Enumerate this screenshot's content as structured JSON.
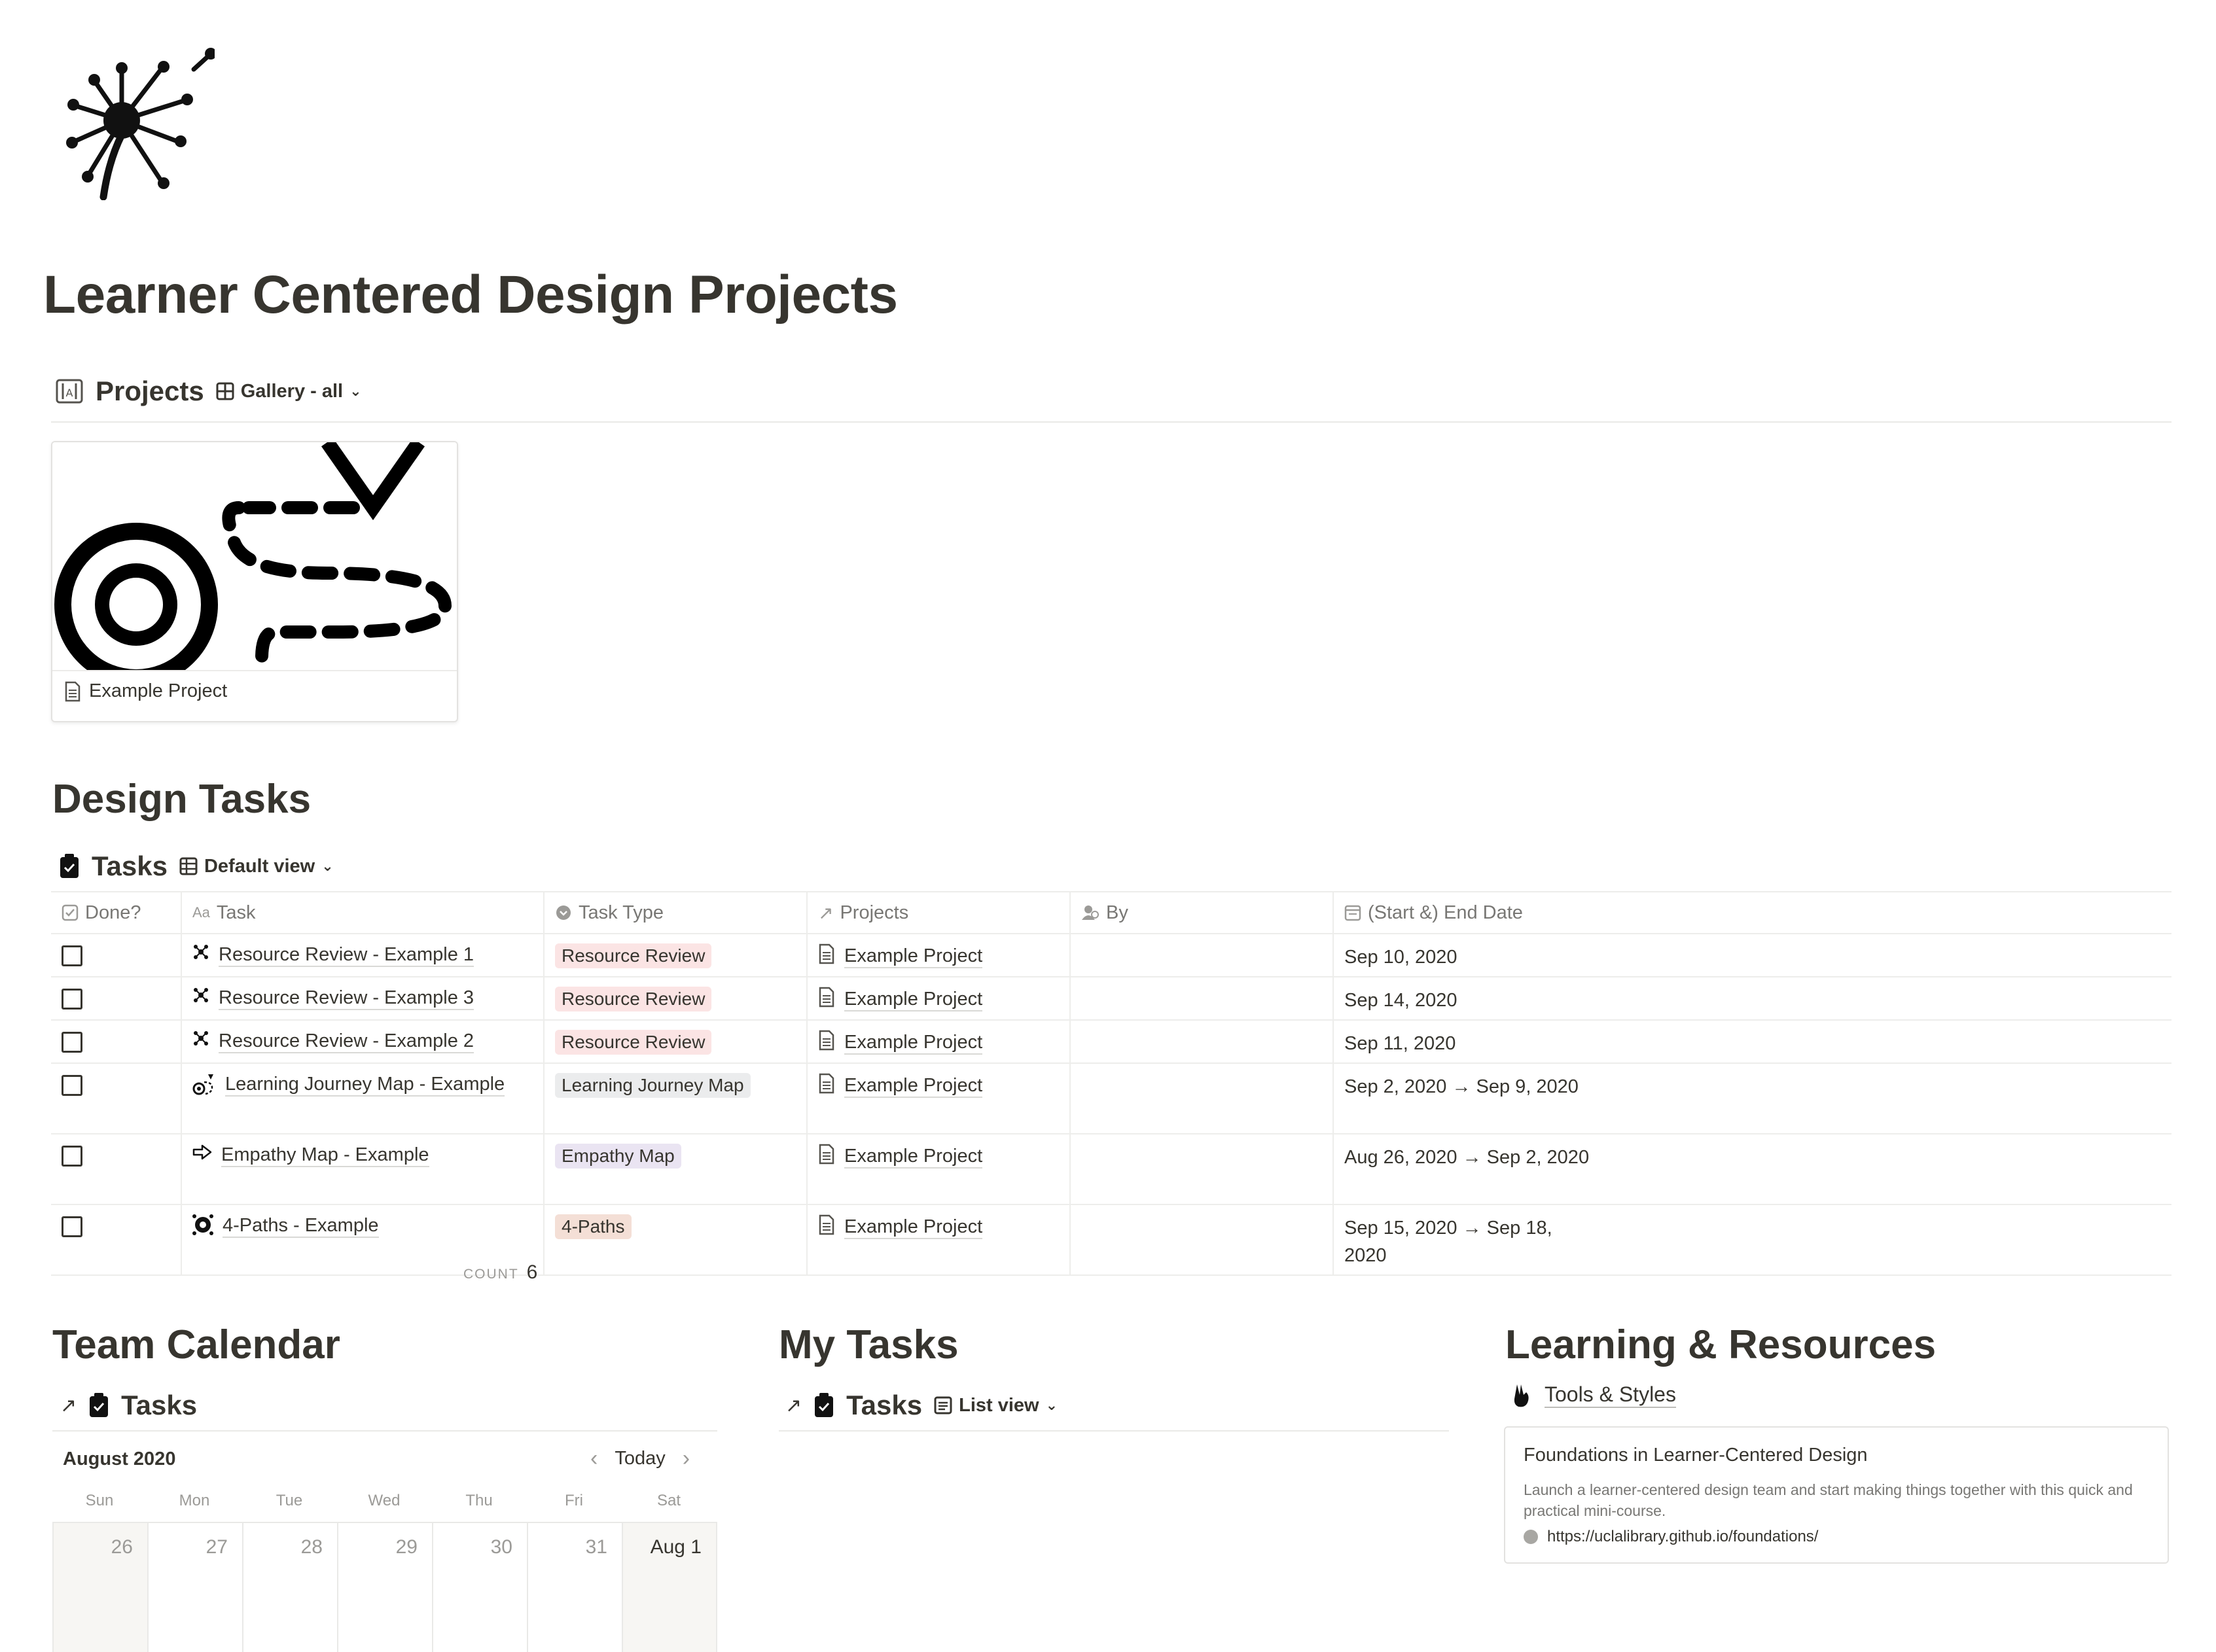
{
  "page": {
    "title": "Learner Centered Design Projects",
    "icon": "dandelion-icon"
  },
  "projects_db": {
    "title": "Projects",
    "view_label": "Gallery - all",
    "cards": [
      {
        "title": "Example Project",
        "icon": "page-icon",
        "cover": "map-route-illustration"
      }
    ]
  },
  "design_tasks": {
    "heading": "Design Tasks",
    "db_title": "Tasks",
    "view_label": "Default view",
    "columns": [
      "Done?",
      "Task",
      "Task Type",
      "Projects",
      "By",
      "(Start &) End Date"
    ],
    "rows": [
      {
        "done": false,
        "task": "Resource Review - Example 1",
        "task_icon": "sparkle-icon",
        "type": "Resource Review",
        "type_color": "#fbe4e4",
        "project": "Example Project",
        "by": "",
        "date": "Sep 10, 2020"
      },
      {
        "done": false,
        "task": "Resource Review - Example 3",
        "task_icon": "sparkle-icon",
        "type": "Resource Review",
        "type_color": "#fbe4e4",
        "project": "Example Project",
        "by": "",
        "date": "Sep 14, 2020"
      },
      {
        "done": false,
        "task": "Resource Review - Example 2",
        "task_icon": "sparkle-icon",
        "type": "Resource Review",
        "type_color": "#fbe4e4",
        "project": "Example Project",
        "by": "",
        "date": "Sep 11, 2020"
      },
      {
        "done": false,
        "task": "Learning Journey Map - Example",
        "task_icon": "journey-icon",
        "type": "Learning Journey Map",
        "type_color": "#ebeced",
        "project": "Example Project",
        "by": "",
        "date": "Sep 2, 2020 → Sep 9, 2020"
      },
      {
        "done": false,
        "task": "Empathy Map - Example",
        "task_icon": "arrow-right-icon",
        "type": "Empathy Map",
        "type_color": "#eae4f2",
        "project": "Example Project",
        "by": "",
        "date": "Aug 26, 2020 → Sep 2, 2020"
      },
      {
        "done": false,
        "task": "4-Paths - Example",
        "task_icon": "compass-icon",
        "type": "4-Paths",
        "type_color": "#f4dfd6",
        "project": "Example Project",
        "by": "",
        "date": "Sep 15, 2020 → Sep 18, 2020"
      }
    ],
    "count_label": "COUNT",
    "count_value": "6"
  },
  "team_calendar": {
    "heading": "Team Calendar",
    "db_title": "Tasks",
    "month": "August 2020",
    "today_label": "Today",
    "weekdays": [
      "Sun",
      "Mon",
      "Tue",
      "Wed",
      "Thu",
      "Fri",
      "Sat"
    ],
    "days": [
      "26",
      "27",
      "28",
      "29",
      "30",
      "31",
      "Aug 1"
    ]
  },
  "my_tasks": {
    "heading": "My Tasks",
    "db_title": "Tasks",
    "view_label": "List view"
  },
  "learning": {
    "heading": "Learning & Resources",
    "link_label": "Tools & Styles",
    "bookmark": {
      "title": "Foundations in Learner-Centered Design",
      "description": "Launch a learner-centered design team and start making things together with this quick and practical mini-course.",
      "url": "https://uclalibrary.github.io/foundations/"
    }
  }
}
